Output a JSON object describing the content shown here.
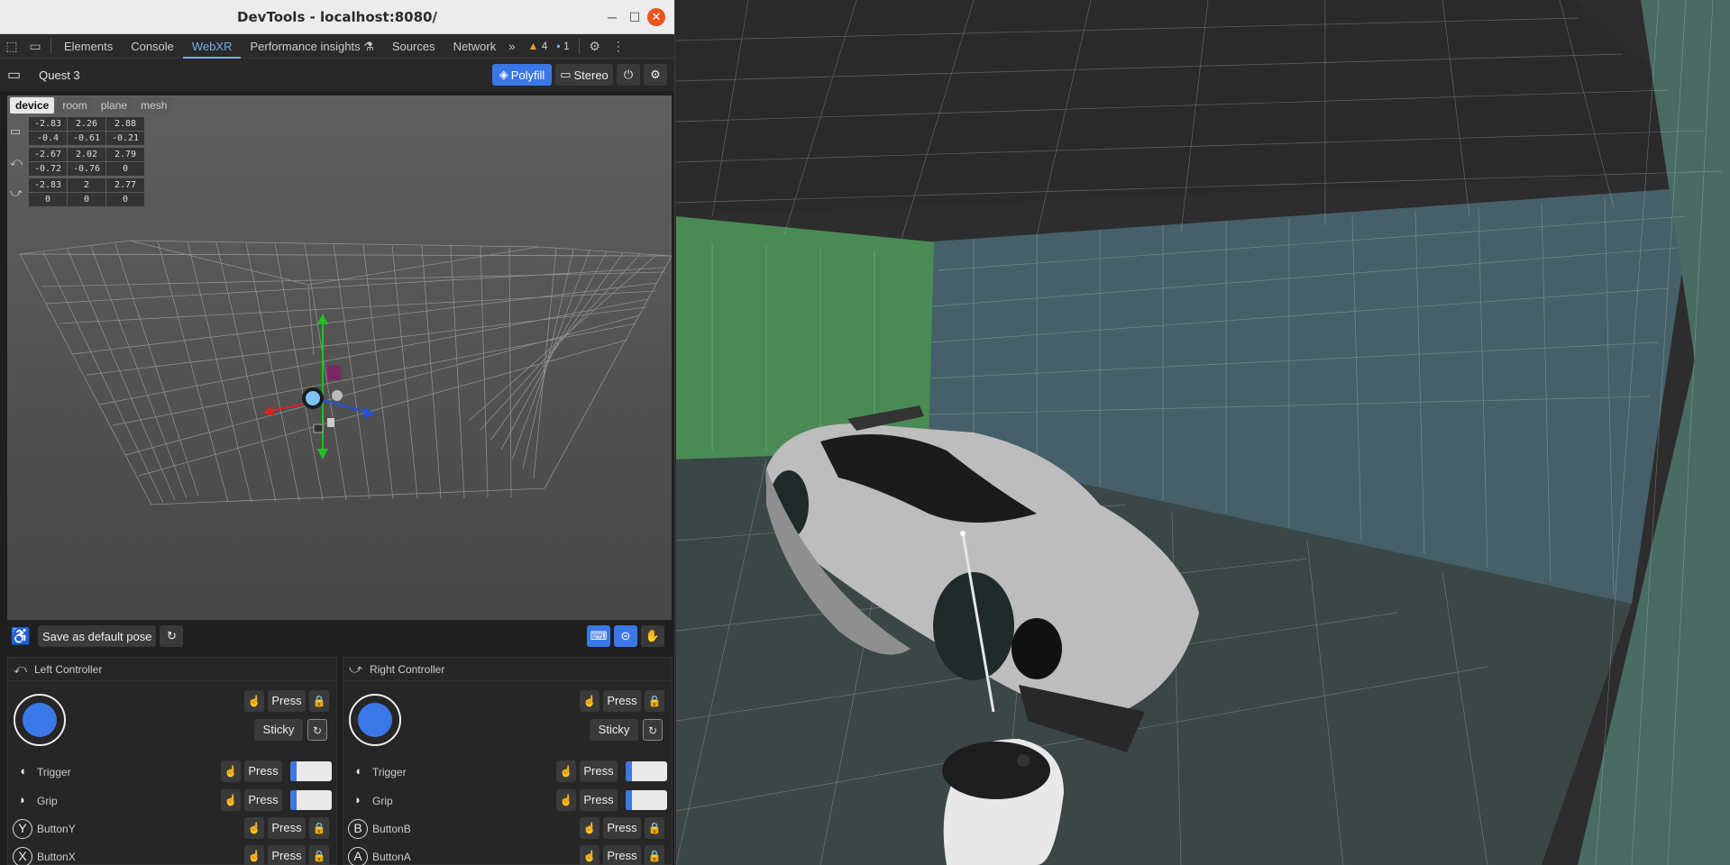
{
  "window": {
    "title": "DevTools - localhost:8080/"
  },
  "tabs": [
    {
      "label": "Elements"
    },
    {
      "label": "Console"
    },
    {
      "label": "WebXR"
    },
    {
      "label": "Performance insights ⚗"
    },
    {
      "label": "Sources"
    },
    {
      "label": "Network"
    }
  ],
  "badges": {
    "warnings": "4",
    "messages": "1"
  },
  "xr": {
    "device": "Quest 3",
    "polyfill": "Polyfill",
    "stereo": "Stereo"
  },
  "viewtabs": [
    "device",
    "room",
    "plane",
    "mesh"
  ],
  "poses": [
    {
      "name": "headset",
      "values": [
        "-2.83",
        "2.26",
        "2.88",
        "-0.4",
        "-0.61",
        "-0.21"
      ]
    },
    {
      "name": "left-controller",
      "values": [
        "-2.67",
        "2.02",
        "2.79",
        "-0.72",
        "-0.76",
        "0"
      ]
    },
    {
      "name": "right-controller",
      "values": [
        "-2.83",
        "2",
        "2.77",
        "0",
        "0",
        "0"
      ]
    }
  ],
  "bottombar": {
    "save_pose": "Save as default pose"
  },
  "left": {
    "title": "Left Controller",
    "press": "Press",
    "sticky": "Sticky",
    "buttons": [
      {
        "label": "Trigger",
        "mode": "slider",
        "level": 0.15
      },
      {
        "label": "Grip",
        "mode": "slider",
        "level": 0.15
      },
      {
        "label": "ButtonY",
        "glyph": "Y",
        "mode": "press"
      },
      {
        "label": "ButtonX",
        "glyph": "X",
        "mode": "press"
      }
    ]
  },
  "right": {
    "title": "Right Controller",
    "press": "Press",
    "sticky": "Sticky",
    "buttons": [
      {
        "label": "Trigger",
        "mode": "slider",
        "level": 0.15
      },
      {
        "label": "Grip",
        "mode": "slider",
        "level": 0.15
      },
      {
        "label": "ButtonB",
        "glyph": "B",
        "mode": "press"
      },
      {
        "label": "ButtonA",
        "glyph": "A",
        "mode": "press"
      }
    ]
  },
  "colors": {
    "accent": "#3b78e7",
    "close": "#e95420",
    "wall_green": "#4a8a55",
    "wall_blue": "#46606a"
  }
}
